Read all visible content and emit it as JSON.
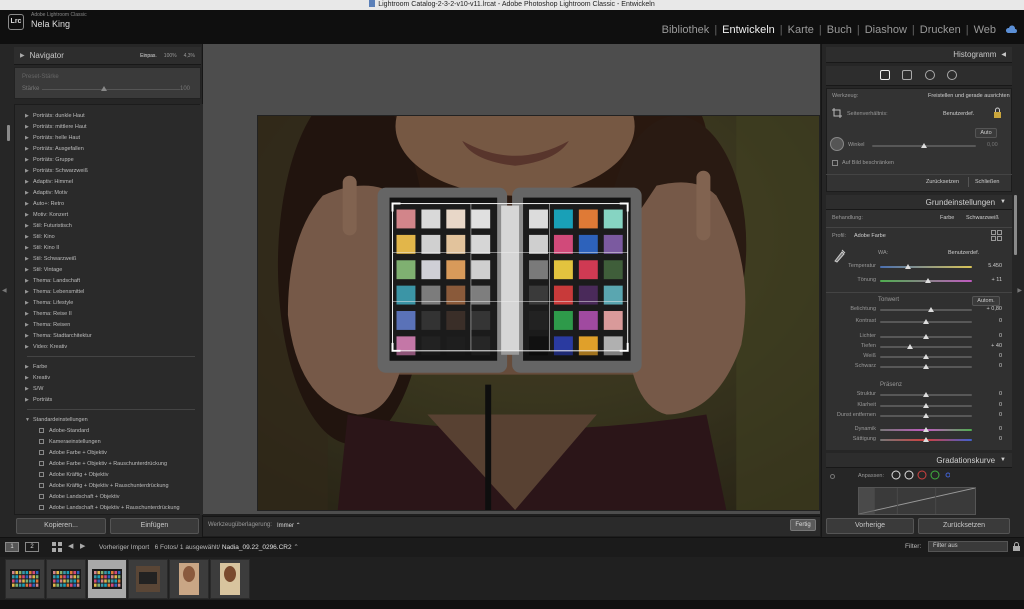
{
  "window": {
    "title": "Lightroom Catalog-2-3-2-v10-v11.lrcat - Adobe Photoshop Lightroom Classic - Entwickeln"
  },
  "identity": {
    "logo": "Lrc",
    "app_name": "Adobe Lightroom Classic",
    "user_name": "Nela King"
  },
  "modules": [
    {
      "label": "Bibliothek",
      "active": false
    },
    {
      "label": "Entwickeln",
      "active": true
    },
    {
      "label": "Karte",
      "active": false
    },
    {
      "label": "Buch",
      "active": false
    },
    {
      "label": "Diashow",
      "active": false
    },
    {
      "label": "Drucken",
      "active": false
    },
    {
      "label": "Web",
      "active": false
    }
  ],
  "navigator": {
    "title": "Navigator",
    "zoom_fit": "Einpas.",
    "zoom_100": "100%",
    "zoom_other": "4,3%"
  },
  "preset_amount": {
    "label": "Preset-Stärke",
    "slider_name": "Stärke",
    "value": "100",
    "level": 0.45
  },
  "presets": {
    "group1": [
      "Porträts: dunkle Haut",
      "Porträts: mittlere Haut",
      "Porträts: helle Haut",
      "Porträts: Ausgefallen",
      "Porträts: Gruppe",
      "Porträts: Schwarzweiß",
      "Adaptiv: Himmel",
      "Adaptiv: Motiv",
      "Auto+: Retro",
      "Motiv: Konzert",
      "Stil: Futuristisch",
      "Stil: Kino",
      "Stil: Kino II",
      "Stil: Schwarzweiß",
      "Stil: Vintage",
      "Thema: Landschaft",
      "Thema: Lebensmittel",
      "Thema: Lifestyle",
      "Thema: Reise II",
      "Thema: Reisen",
      "Thema: Stadtarchitektur",
      "Video: Kreativ"
    ],
    "group2": [
      "Farbe",
      "Kreativ",
      "S/W",
      "Porträts"
    ],
    "standard_group": "Standardeinstellungen",
    "standard_items": [
      "Adobe-Standard",
      "Kameraeinstellungen",
      "Adobe Farbe + Objektiv",
      "Adobe Farbe + Objektiv + Rauschunterdrückung",
      "Adobe Kräftig + Objektiv",
      "Adobe Kräftig + Objektiv + Rauschunterdrückung",
      "Adobe Landschaft + Objektiv",
      "Adobe Landschaft + Objektiv + Rauschunterdrückung"
    ]
  },
  "left_buttons": {
    "copy": "Kopieren...",
    "paste": "Einfügen"
  },
  "toolbar": {
    "overlay_label": "Werkzeugüberlagerung:",
    "overlay_value": "Immer",
    "done": "Fertig"
  },
  "histogram": {
    "title": "Histogramm"
  },
  "crop": {
    "tool_label": "Werkzeug:",
    "tool_value": "Freistellen und gerade ausrichten",
    "aspect_label": "Seitenverhältnis:",
    "aspect_value": "Benutzerdef.",
    "auto": "Auto",
    "angle_label": "Winkel",
    "angle_value": "0,00",
    "constrain_label": "Auf Bild beschränken",
    "reset": "Zurücksetzen",
    "close": "Schließen"
  },
  "basic": {
    "title": "Grundeinstellungen",
    "treatment_label": "Behandlung:",
    "treatment_color": "Farbe",
    "treatment_bw": "Schwarzweiß",
    "profile_label": "Profil:",
    "profile_value": "Adobe Farbe",
    "wb_label": "WA:",
    "wb_value": "Benutzerdef.",
    "tone_title": "Tonwert",
    "tone_auto": "Autom.",
    "presence_title": "Präsenz",
    "sliders": [
      {
        "label": "Temperatur",
        "value": "5.450",
        "pos": 0.3
      },
      {
        "label": "Tönung",
        "value": "+ 11",
        "pos": 0.52
      },
      {
        "label": "Belichtung",
        "value": "+ 0,80",
        "pos": 0.55
      },
      {
        "label": "Kontrast",
        "value": "0",
        "pos": 0.5
      },
      {
        "label": "Lichter",
        "value": "0",
        "pos": 0.5
      },
      {
        "label": "Tiefen",
        "value": "+ 40",
        "pos": 0.33
      },
      {
        "label": "Weiß",
        "value": "0",
        "pos": 0.5
      },
      {
        "label": "Schwarz",
        "value": "0",
        "pos": 0.5
      },
      {
        "label": "Struktur",
        "value": "0",
        "pos": 0.5
      },
      {
        "label": "Klarheit",
        "value": "0",
        "pos": 0.5
      },
      {
        "label": "Dunst entfernen",
        "value": "0",
        "pos": 0.5
      },
      {
        "label": "Dynamik",
        "value": "0",
        "pos": 0.5
      },
      {
        "label": "Sättigung",
        "value": "0",
        "pos": 0.5
      }
    ]
  },
  "gradation": {
    "title": "Gradationskurve",
    "adjust_label": "Anpassen:"
  },
  "right_buttons": {
    "previous": "Vorherige",
    "reset": "Zurücksetzen"
  },
  "filmstrip": {
    "monitor1": "1",
    "monitor2": "2",
    "source": "Vorheriger Import",
    "count": "6 Fotos/ 1 ausgewählt/",
    "filename": "Nadia_09.22_0296.CR2",
    "filter_label": "Filter:",
    "filter_value": "Filter aus"
  },
  "colors": {
    "accent_active": "#f0f0f0",
    "panel_bg": "#262626",
    "center_bg": "#4d4d4d"
  }
}
